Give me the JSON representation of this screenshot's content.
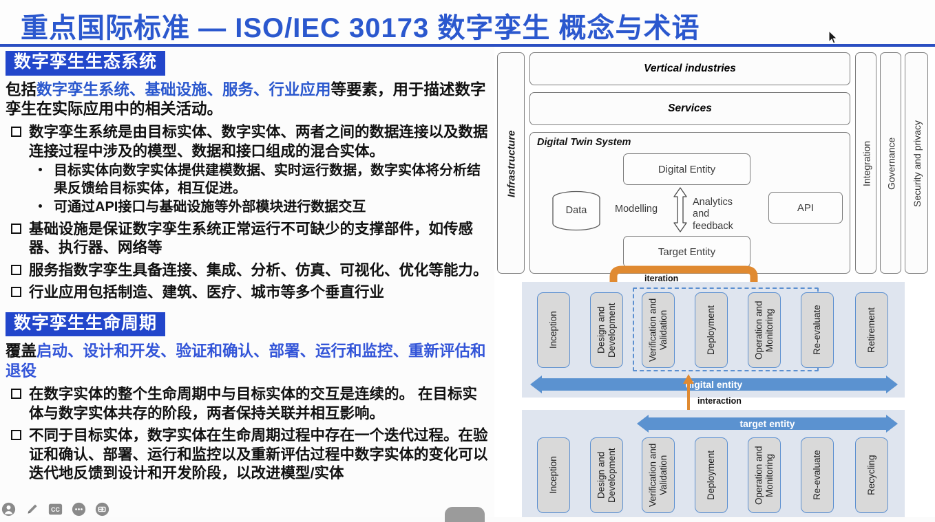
{
  "slide": {
    "title": "重点国际标准 — ISO/IEC 30173 数字孪生 概念与术语",
    "title_color": "#2B58CE",
    "rule_color": "#2B4FC2"
  },
  "left_panel": {
    "section1": {
      "badge": "数字孪生生态系统",
      "badge_bg": "#2246CB",
      "lead_prefix": "包括",
      "lead_highlight": "数字孪生系统、基础设施、服务、行业应用",
      "lead_suffix": "等要素，用于描述数字孪生在实际应用中的相关活动。",
      "bullets": [
        {
          "level": 1,
          "text": "数字孪生系统是由目标实体、数字实体、两者之间的数据连接以及数据连接过程中涉及的模型、数据和接口组成的混合实体。"
        },
        {
          "level": 2,
          "text": "目标实体向数字实体提供建模数据、实时运行数据，数字实体将分析结果反馈给目标实体，相互促进。"
        },
        {
          "level": 2,
          "text": "可通过API接口与基础设施等外部模块进行数据交互"
        },
        {
          "level": 1,
          "text": "基础设施是保证数字孪生系统正常运行不可缺少的支撑部件，如传感器、执行器、网络等"
        },
        {
          "level": 1,
          "text": "服务指数字孪生具备连接、集成、分析、仿真、可视化、优化等能力。"
        },
        {
          "level": 1,
          "text": "行业应用包括制造、建筑、医疗、城市等多个垂直行业"
        }
      ]
    },
    "section2": {
      "badge": "数字孪生生命周期",
      "badge_bg": "#2246CB",
      "lead_prefix": "覆盖",
      "lead_highlight": "启动、设计和开发、验证和确认、部署、运行和监控、重新评估和退役",
      "bullets": [
        {
          "level": 1,
          "text": "在数字实体的整个生命周期中与目标实体的交互是连续的。 在目标实体与数字实体共存的阶段，两者保持关联并相互影响。"
        },
        {
          "level": 1,
          "text": "不同于目标实体，数字实体在生命周期过程中存在一个迭代过程。在验证和确认、部署、运行和监控以及重新评估过程中数字实体的变化可以迭代地反馈到设计和开发阶段，以改进模型/实体"
        }
      ]
    }
  },
  "toolbar": {
    "icons": [
      "person-icon",
      "pencil-icon",
      "closed-caption-icon",
      "emoji-icon",
      "share-screen-icon"
    ],
    "time_badge": ""
  },
  "diagram": {
    "architecture": {
      "left_column_label": "Infrastructure",
      "layers": [
        "Vertical industries",
        "Services"
      ],
      "system_label": "Digital Twin System",
      "nodes": {
        "digital_entity": "Digital Entity",
        "data": "Data",
        "modelling": "Modelling",
        "analytics": "Analytics and feedback",
        "api": "API",
        "target_entity": "Target Entity"
      },
      "right_columns": [
        "Integration",
        "Governance",
        "Security and privacy"
      ]
    },
    "lifecycle": {
      "iteration_label": "iteration",
      "interaction_label": "interaction",
      "digital_entity_label": "digital entity",
      "target_entity_label": "target entity",
      "digital_stages": [
        "Inception",
        "Design and Development",
        "Verification and Validation",
        "Deployment",
        "Operation and Monitoring",
        "Re-evaluate",
        "Retirement"
      ],
      "target_stages": [
        "Inception",
        "Design and Development",
        "Verification and Validation",
        "Deployment",
        "Operation and Monitoring",
        "Re-evaluate",
        "Recycling"
      ]
    },
    "colors": {
      "stage_border": "#5b8fd0",
      "stage_fill": "#d9d9d9",
      "band": "#dfe5ef",
      "arrow_blue": "#5b92d0",
      "arrow_orange": "#E08A31"
    }
  }
}
